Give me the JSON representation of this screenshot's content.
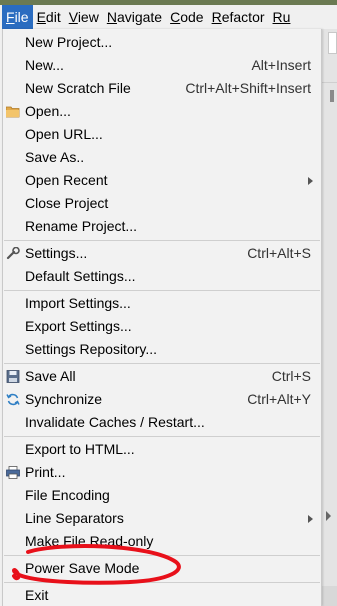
{
  "menubar": {
    "menus": [
      {
        "key": "F",
        "rest": "ile",
        "active": true
      },
      {
        "key": "E",
        "rest": "dit"
      },
      {
        "key": "V",
        "rest": "iew"
      },
      {
        "key": "N",
        "rest": "avigate"
      },
      {
        "key": "C",
        "rest": "ode"
      },
      {
        "key": "R",
        "rest": "efactor"
      },
      {
        "key": "Ru",
        "rest": ""
      }
    ]
  },
  "file_menu": {
    "items": [
      {
        "label": "New Project..."
      },
      {
        "label": "New...",
        "shortcut": "Alt+Insert"
      },
      {
        "label": "New Scratch File",
        "shortcut": "Ctrl+Alt+Shift+Insert"
      },
      {
        "label": "Open...",
        "icon": "folder-icon"
      },
      {
        "label": "Open URL..."
      },
      {
        "label": "Save As.."
      },
      {
        "label": "Open Recent",
        "submenu": true
      },
      {
        "label": "Close Project"
      },
      {
        "label": "Rename Project..."
      },
      {
        "label": "Settings...",
        "shortcut": "Ctrl+Alt+S",
        "icon": "wrench-icon"
      },
      {
        "label": "Default Settings..."
      },
      {
        "label": "Import Settings..."
      },
      {
        "label": "Export Settings..."
      },
      {
        "label": "Settings Repository..."
      },
      {
        "label": "Save All",
        "shortcut": "Ctrl+S",
        "icon": "save-icon"
      },
      {
        "label": "Synchronize",
        "shortcut": "Ctrl+Alt+Y",
        "icon": "sync-icon"
      },
      {
        "label": "Invalidate Caches / Restart..."
      },
      {
        "label": "Export to HTML..."
      },
      {
        "label": "Print...",
        "icon": "printer-icon"
      },
      {
        "label": "File Encoding"
      },
      {
        "label": "Line Separators",
        "submenu": true
      },
      {
        "label": "Make File Read-only"
      },
      {
        "label": "Power Save Mode"
      },
      {
        "label": "Exit"
      }
    ]
  },
  "colors": {
    "menu_active_bg": "#2a6cc0",
    "annotation": "#e8101a"
  }
}
